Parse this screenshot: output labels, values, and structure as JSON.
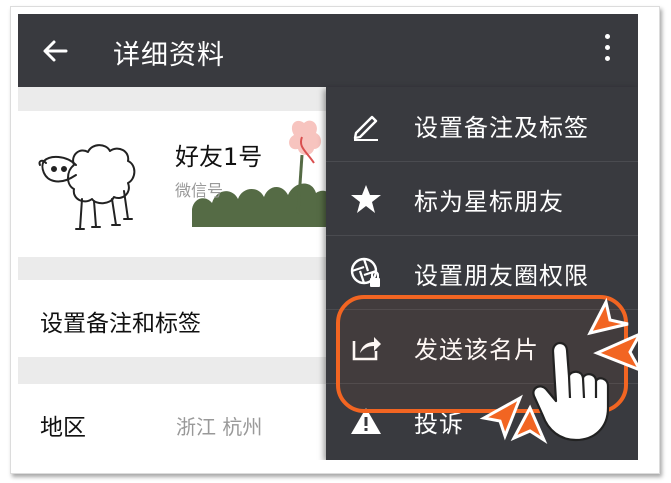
{
  "appbar": {
    "title": "详细资料",
    "back_icon": "arrow-left-icon",
    "more_icon": "more-vertical-icon"
  },
  "profile": {
    "name": "好友1号",
    "wechat_id": "微信号",
    "avatar_icon": "sheep-avatar"
  },
  "rows": {
    "remark_label": "设置备注和标签",
    "region_label": "地区",
    "region_value": "浙江  杭州"
  },
  "menu": {
    "items": [
      {
        "label": "设置备注及标签",
        "icon": "pencil-icon"
      },
      {
        "label": "标为星标朋友",
        "icon": "star-icon"
      },
      {
        "label": "设置朋友圈权限",
        "icon": "aperture-lock-icon"
      },
      {
        "label": "发送该名片",
        "icon": "share-icon"
      },
      {
        "label": "投诉",
        "icon": "warning-icon"
      }
    ]
  },
  "colors": {
    "appbar": "#393a3f",
    "menu": "#393a3f",
    "highlight": "#f26522",
    "background": "#ebebeb"
  }
}
